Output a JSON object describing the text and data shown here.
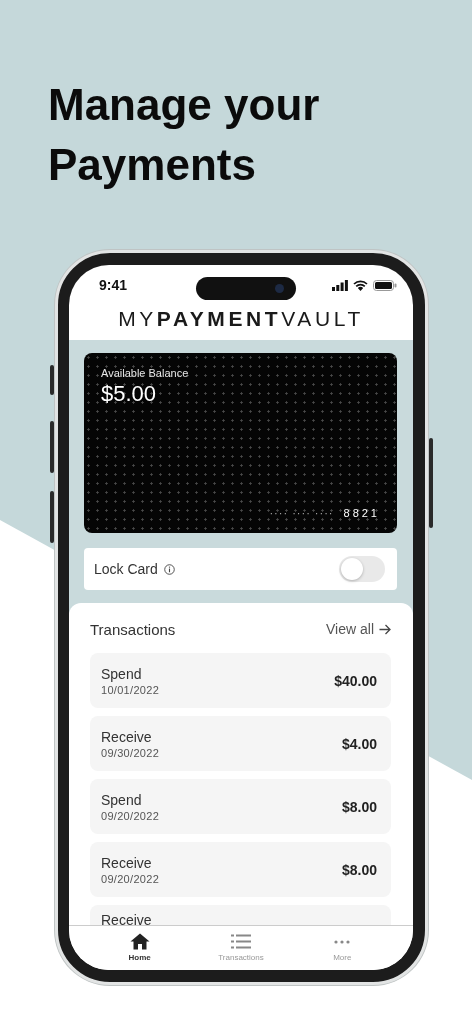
{
  "headline": "Manage your Payments",
  "status_bar": {
    "time": "9:41"
  },
  "logo": "MY**PAYMENT**VAULT",
  "card": {
    "label": "Available Balance",
    "balance": "$5.00",
    "mask": "···· ···· ····",
    "last4": "8821"
  },
  "lock_card": {
    "label": "Lock Card",
    "on": false
  },
  "transactions": {
    "title": "Transactions",
    "view_all": "View all",
    "rows": [
      {
        "type": "Spend",
        "date": "10/01/2022",
        "amount": "$40.00"
      },
      {
        "type": "Receive",
        "date": "09/30/2022",
        "amount": "$4.00"
      },
      {
        "type": "Spend",
        "date": "09/20/2022",
        "amount": "$8.00"
      },
      {
        "type": "Receive",
        "date": "09/20/2022",
        "amount": "$8.00"
      },
      {
        "type": "Receive"
      }
    ]
  },
  "tab_bar": [
    {
      "kind": "home",
      "label": "Home",
      "selected": true
    },
    {
      "kind": "list",
      "label": "Transactions",
      "selected": false
    },
    {
      "kind": "more",
      "label": "More",
      "selected": false
    }
  ]
}
